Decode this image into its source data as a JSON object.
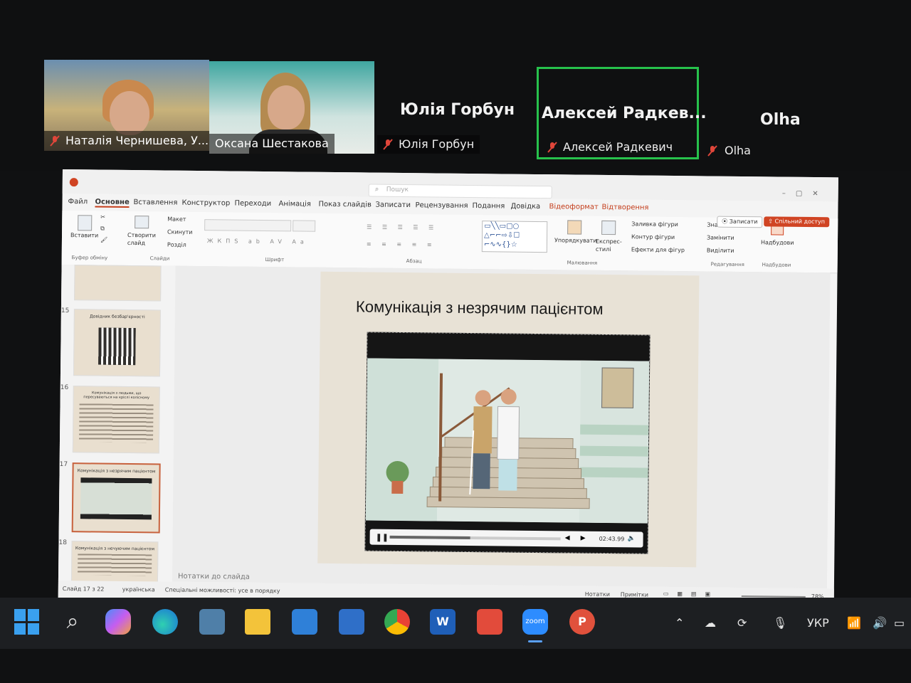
{
  "zoom": {
    "participants": [
      {
        "display_name": "Наталія Чернишева, У...",
        "muted": true
      },
      {
        "display_name": "Оксана Шестакова",
        "muted": false
      },
      {
        "display_name": "Юлія Горбун",
        "label": "Юлія Горбун",
        "muted": true
      },
      {
        "display_name": "Алексей Радкевич",
        "label": "Алексей Радкев...",
        "muted": true,
        "active_speaker": true
      },
      {
        "display_name": "Olha",
        "label": "Olha",
        "muted": true
      }
    ]
  },
  "powerpoint": {
    "search_placeholder": "Пошук",
    "tabs": [
      "Файл",
      "Основне",
      "Вставлення",
      "Конструктор",
      "Переходи",
      "Анімація",
      "Показ слайдів",
      "Записати",
      "Рецензування",
      "Подання",
      "Довідка",
      "Відеоформат",
      "Відтворення"
    ],
    "active_tab": "Основне",
    "record_button": "Записати",
    "share_button": "Спільний доступ",
    "ribbon": {
      "paste": "Вставити",
      "new_slide": "Створити слайд",
      "layout": "Макет",
      "reset": "Скинути",
      "section": "Розділ",
      "group_clipboard": "Буфер обміну",
      "group_slides": "Слайди",
      "group_font": "Шрифт",
      "group_paragraph": "Абзац",
      "arrange": "Упорядкувати",
      "quick_styles": "Експрес-стилі",
      "shape_fill": "Заливка фігури",
      "shape_outline": "Контур фігури",
      "shape_effects": "Ефекти для фігур",
      "group_drawing": "Малювання",
      "find": "Знайти",
      "replace": "Замінити",
      "select": "Виділити",
      "group_editing": "Редагування",
      "addins": "Надбудови",
      "group_addins": "Надбудови"
    },
    "thumbnails": [
      {
        "num": "15",
        "title": "Довідник безбар'єрності"
      },
      {
        "num": "16",
        "title": "Комунікація з людьми, що пересуваються на кріслі колісному"
      },
      {
        "num": "17",
        "title": "Комунікація з незрячим пацієнтом",
        "selected": true
      },
      {
        "num": "18",
        "title": "Комунікація з нечуючим пацієнтом"
      }
    ],
    "slide_title": "Комунікація з незрячим пацієнтом",
    "video_time": "02:43.99",
    "video_progress": 0.47,
    "notes_placeholder": "Нотатки до слайда",
    "status": {
      "slide_of": "Слайд 17 з 22",
      "language": "українська",
      "accessibility": "Спеціальні можливості: усе в порядку",
      "notes": "Нотатки",
      "comments": "Примітки",
      "zoom_level": "78%"
    }
  },
  "taskbar": {
    "apps": [
      "start",
      "search",
      "copilot",
      "edge",
      "calculator",
      "explorer",
      "calendar",
      "save",
      "chrome",
      "word",
      "anydesk",
      "zoom",
      "pixel"
    ],
    "zoom_label": "zoom",
    "language": "УКР"
  }
}
